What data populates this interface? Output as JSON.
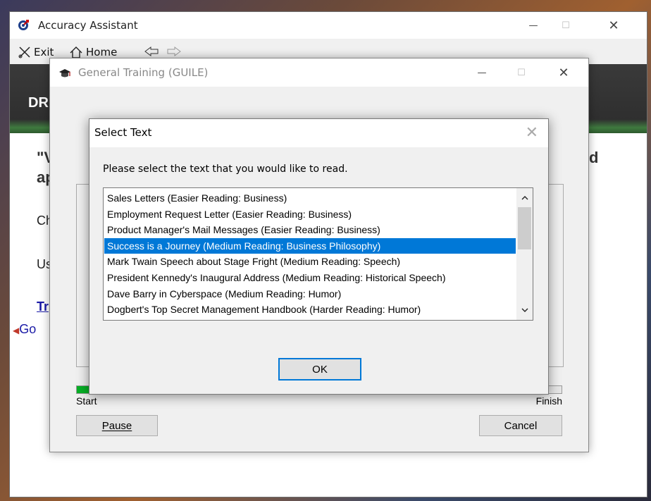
{
  "main_window": {
    "title": "Accuracy Assistant",
    "controls": {
      "minimize": "—",
      "maximize": "☐",
      "close": "✕"
    },
    "toolbar": {
      "exit_label": "Exit",
      "home_label": "Home",
      "back_label": "",
      "forward_label": ""
    },
    "header_text": "DR",
    "body": {
      "quote_line1": "\"V",
      "quote_right": "d",
      "quote_line2": "ap",
      "line_ch": "Ch",
      "line_us": "Us",
      "link_tr": "Tr",
      "go_label": "Go"
    }
  },
  "training_window": {
    "title": "General Training (GUILE)",
    "controls": {
      "minimize": "—",
      "maximize": "☐",
      "close": "✕"
    },
    "progress": {
      "fraction": 0.03,
      "start_label": "Start",
      "finish_label": "Finish"
    },
    "pause_label": "Pause",
    "cancel_label": "Cancel"
  },
  "select_dialog": {
    "title": "Select Text",
    "close": "✕",
    "prompt": "Please select the text that you would like to read.",
    "items": [
      "Sales Letters (Easier Reading: Business)",
      "Employment Request Letter (Easier Reading: Business)",
      "Product Manager's Mail Messages (Easier Reading: Business)",
      "Success is a Journey (Medium Reading: Business Philosophy)",
      "Mark Twain Speech about Stage Fright (Medium Reading: Speech)",
      "President Kennedy's Inaugural Address (Medium Reading: Historical Speech)",
      "Dave Barry in Cyberspace (Medium Reading: Humor)",
      "Dogbert's Top Secret Management Handbook (Harder Reading: Humor)"
    ],
    "selected_index": 3,
    "scroll_up": "^",
    "scroll_down": "v",
    "ok_label": "OK"
  },
  "colors": {
    "selection": "#0078d7",
    "progress_fill": "#06b025",
    "link": "#1a1aa6"
  }
}
